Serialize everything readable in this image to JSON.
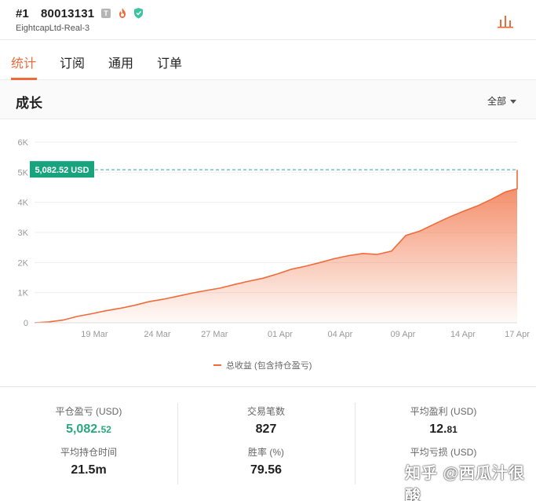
{
  "header": {
    "rank": "#1",
    "account": "80013131",
    "badge_t": "T",
    "broker": "EightcapLtd-Real-3"
  },
  "tabs": [
    {
      "label": "统计",
      "active": true
    },
    {
      "label": "订阅",
      "active": false
    },
    {
      "label": "通用",
      "active": false
    },
    {
      "label": "订单",
      "active": false
    }
  ],
  "growth": {
    "title": "成长",
    "range": "全部"
  },
  "chart_data": {
    "type": "area",
    "title": "",
    "xlabel": "",
    "ylabel": "",
    "ylim": [
      0,
      6000
    ],
    "yticks": [
      "0",
      "1K",
      "2K",
      "3K",
      "4K",
      "5K",
      "6K"
    ],
    "xticks": [
      "19 Mar",
      "24 Mar",
      "27 Mar",
      "01 Apr",
      "04 Apr",
      "09 Apr",
      "14 Apr",
      "17 Apr"
    ],
    "current_label": "5,082.52 USD",
    "current_value": 5082.52,
    "grid": true,
    "legend_position": "bottom",
    "series": [
      {
        "name": "总收益 (包含持仓盈亏)",
        "color": "#f06a3a",
        "x": [
          0,
          0.5,
          1,
          1.5,
          2,
          2.5,
          3,
          3.5,
          4,
          4.5,
          5,
          5.5,
          6,
          6.5,
          7,
          7.5,
          8,
          8.5,
          9,
          9.5,
          10,
          10.5,
          11,
          11.5,
          12,
          12.5,
          13,
          13.5,
          14,
          14.5,
          15,
          15.5,
          16,
          16.5,
          16.9
        ],
        "y": [
          0,
          30,
          90,
          210,
          300,
          400,
          480,
          580,
          700,
          780,
          880,
          980,
          1070,
          1150,
          1270,
          1380,
          1480,
          1620,
          1780,
          1880,
          2000,
          2130,
          2230,
          2300,
          2270,
          2380,
          2900,
          3050,
          3280,
          3500,
          3700,
          3880,
          4100,
          4350,
          4450
        ]
      }
    ]
  },
  "stats": {
    "close_pnl_label": "平仓盈亏 (USD)",
    "close_pnl_int": "5,082.",
    "close_pnl_frac": "52",
    "trades_label": "交易笔数",
    "trades_value": "827",
    "avg_profit_label": "平均盈利 (USD)",
    "avg_profit_int": "12.",
    "avg_profit_frac": "81",
    "avg_hold_label": "平均持仓时间",
    "avg_hold_value": "21.5m",
    "win_rate_label": "胜率 (%)",
    "win_rate_value": "79.56",
    "avg_loss_label": "平均亏损 (USD)"
  },
  "watermark": "知乎 @西瓜汁很酸",
  "colors": {
    "accent": "#f06a3a",
    "positive": "#2aa77e",
    "current_tag": "#16a37d"
  }
}
